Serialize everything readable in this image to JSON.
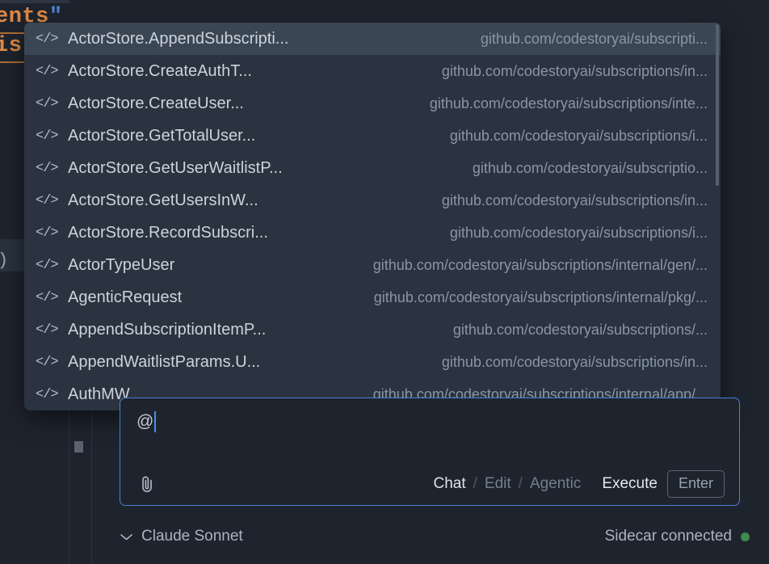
{
  "editor": {
    "code_fragment_1": "ents",
    "code_quote": "\"",
    "code_fragment_2": "is",
    "gutter_paren": ")"
  },
  "autocomplete": {
    "icon": "code-symbol-icon",
    "items": [
      {
        "label": "ActorStore.AppendSubscripti...",
        "path": "github.com/codestoryai/subscripti...",
        "selected": true
      },
      {
        "label": "ActorStore.CreateAuthT...",
        "path": "github.com/codestoryai/subscriptions/in...",
        "selected": false
      },
      {
        "label": "ActorStore.CreateUser...",
        "path": "github.com/codestoryai/subscriptions/inte...",
        "selected": false
      },
      {
        "label": "ActorStore.GetTotalUser...",
        "path": "github.com/codestoryai/subscriptions/i...",
        "selected": false
      },
      {
        "label": "ActorStore.GetUserWaitlistP...",
        "path": "github.com/codestoryai/subscriptio...",
        "selected": false
      },
      {
        "label": "ActorStore.GetUsersInW...",
        "path": "github.com/codestoryai/subscriptions/in...",
        "selected": false
      },
      {
        "label": "ActorStore.RecordSubscri...",
        "path": "github.com/codestoryai/subscriptions/i...",
        "selected": false
      },
      {
        "label": "ActorTypeUser",
        "path": "github.com/codestoryai/subscriptions/internal/gen/...",
        "selected": false
      },
      {
        "label": "AgenticRequest",
        "path": "github.com/codestoryai/subscriptions/internal/pkg/...",
        "selected": false
      },
      {
        "label": "AppendSubscriptionItemP...",
        "path": "github.com/codestoryai/subscriptions/...",
        "selected": false
      },
      {
        "label": "AppendWaitlistParams.U...",
        "path": "github.com/codestoryai/subscriptions/in...",
        "selected": false
      },
      {
        "label": "AuthMW",
        "path": "github.com/codestoryai/subscriptions/internal/app/...",
        "selected": false
      }
    ]
  },
  "chat": {
    "input_value": "@",
    "attach_icon": "paperclip-icon",
    "modes": [
      {
        "label": "Chat",
        "active": true
      },
      {
        "label": "Edit",
        "active": false
      },
      {
        "label": "Agentic",
        "active": false
      }
    ],
    "separator": "/",
    "execute_label": "Execute",
    "enter_key_label": "Enter"
  },
  "status": {
    "model_name": "Claude Sonnet",
    "chevron_icon": "chevron-down-icon",
    "connection_text": "Sidecar connected",
    "connection_color": "#3f8a4f"
  }
}
